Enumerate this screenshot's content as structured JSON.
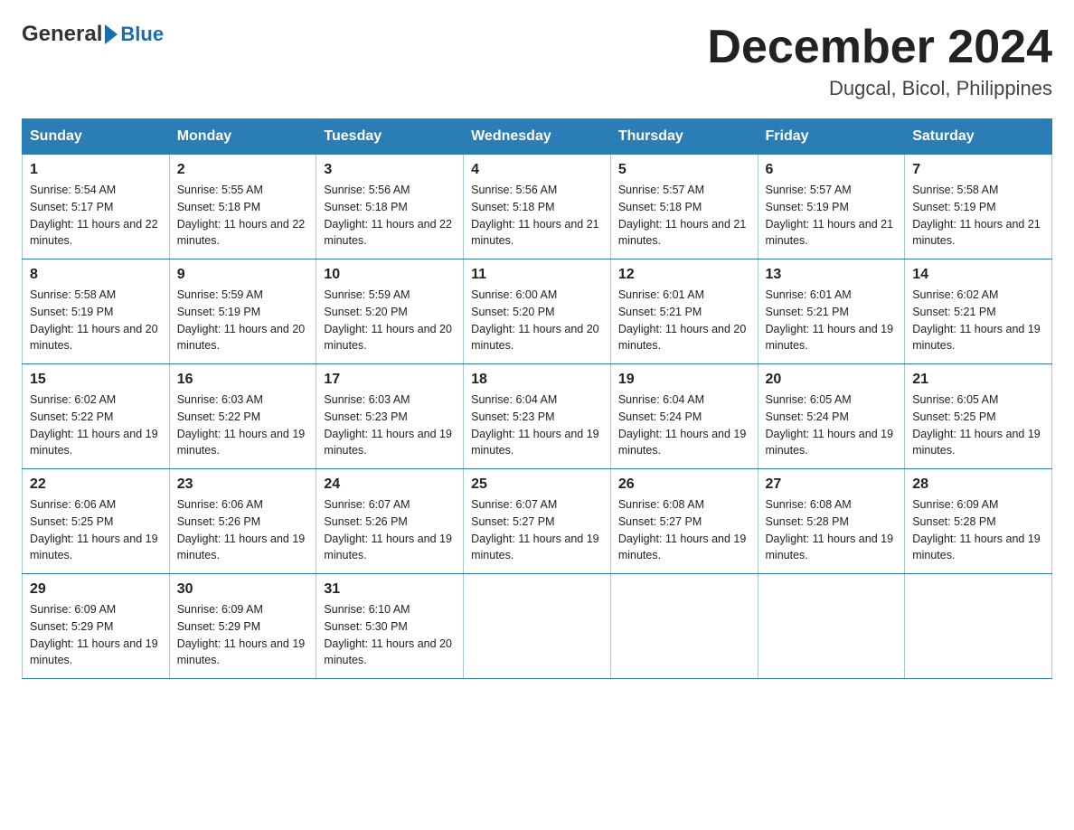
{
  "logo": {
    "general": "General",
    "blue": "Blue"
  },
  "title": "December 2024",
  "subtitle": "Dugcal, Bicol, Philippines",
  "days": [
    "Sunday",
    "Monday",
    "Tuesday",
    "Wednesday",
    "Thursday",
    "Friday",
    "Saturday"
  ],
  "weeks": [
    [
      {
        "num": "1",
        "sunrise": "5:54 AM",
        "sunset": "5:17 PM",
        "daylight": "11 hours and 22 minutes."
      },
      {
        "num": "2",
        "sunrise": "5:55 AM",
        "sunset": "5:18 PM",
        "daylight": "11 hours and 22 minutes."
      },
      {
        "num": "3",
        "sunrise": "5:56 AM",
        "sunset": "5:18 PM",
        "daylight": "11 hours and 22 minutes."
      },
      {
        "num": "4",
        "sunrise": "5:56 AM",
        "sunset": "5:18 PM",
        "daylight": "11 hours and 21 minutes."
      },
      {
        "num": "5",
        "sunrise": "5:57 AM",
        "sunset": "5:18 PM",
        "daylight": "11 hours and 21 minutes."
      },
      {
        "num": "6",
        "sunrise": "5:57 AM",
        "sunset": "5:19 PM",
        "daylight": "11 hours and 21 minutes."
      },
      {
        "num": "7",
        "sunrise": "5:58 AM",
        "sunset": "5:19 PM",
        "daylight": "11 hours and 21 minutes."
      }
    ],
    [
      {
        "num": "8",
        "sunrise": "5:58 AM",
        "sunset": "5:19 PM",
        "daylight": "11 hours and 20 minutes."
      },
      {
        "num": "9",
        "sunrise": "5:59 AM",
        "sunset": "5:19 PM",
        "daylight": "11 hours and 20 minutes."
      },
      {
        "num": "10",
        "sunrise": "5:59 AM",
        "sunset": "5:20 PM",
        "daylight": "11 hours and 20 minutes."
      },
      {
        "num": "11",
        "sunrise": "6:00 AM",
        "sunset": "5:20 PM",
        "daylight": "11 hours and 20 minutes."
      },
      {
        "num": "12",
        "sunrise": "6:01 AM",
        "sunset": "5:21 PM",
        "daylight": "11 hours and 20 minutes."
      },
      {
        "num": "13",
        "sunrise": "6:01 AM",
        "sunset": "5:21 PM",
        "daylight": "11 hours and 19 minutes."
      },
      {
        "num": "14",
        "sunrise": "6:02 AM",
        "sunset": "5:21 PM",
        "daylight": "11 hours and 19 minutes."
      }
    ],
    [
      {
        "num": "15",
        "sunrise": "6:02 AM",
        "sunset": "5:22 PM",
        "daylight": "11 hours and 19 minutes."
      },
      {
        "num": "16",
        "sunrise": "6:03 AM",
        "sunset": "5:22 PM",
        "daylight": "11 hours and 19 minutes."
      },
      {
        "num": "17",
        "sunrise": "6:03 AM",
        "sunset": "5:23 PM",
        "daylight": "11 hours and 19 minutes."
      },
      {
        "num": "18",
        "sunrise": "6:04 AM",
        "sunset": "5:23 PM",
        "daylight": "11 hours and 19 minutes."
      },
      {
        "num": "19",
        "sunrise": "6:04 AM",
        "sunset": "5:24 PM",
        "daylight": "11 hours and 19 minutes."
      },
      {
        "num": "20",
        "sunrise": "6:05 AM",
        "sunset": "5:24 PM",
        "daylight": "11 hours and 19 minutes."
      },
      {
        "num": "21",
        "sunrise": "6:05 AM",
        "sunset": "5:25 PM",
        "daylight": "11 hours and 19 minutes."
      }
    ],
    [
      {
        "num": "22",
        "sunrise": "6:06 AM",
        "sunset": "5:25 PM",
        "daylight": "11 hours and 19 minutes."
      },
      {
        "num": "23",
        "sunrise": "6:06 AM",
        "sunset": "5:26 PM",
        "daylight": "11 hours and 19 minutes."
      },
      {
        "num": "24",
        "sunrise": "6:07 AM",
        "sunset": "5:26 PM",
        "daylight": "11 hours and 19 minutes."
      },
      {
        "num": "25",
        "sunrise": "6:07 AM",
        "sunset": "5:27 PM",
        "daylight": "11 hours and 19 minutes."
      },
      {
        "num": "26",
        "sunrise": "6:08 AM",
        "sunset": "5:27 PM",
        "daylight": "11 hours and 19 minutes."
      },
      {
        "num": "27",
        "sunrise": "6:08 AM",
        "sunset": "5:28 PM",
        "daylight": "11 hours and 19 minutes."
      },
      {
        "num": "28",
        "sunrise": "6:09 AM",
        "sunset": "5:28 PM",
        "daylight": "11 hours and 19 minutes."
      }
    ],
    [
      {
        "num": "29",
        "sunrise": "6:09 AM",
        "sunset": "5:29 PM",
        "daylight": "11 hours and 19 minutes."
      },
      {
        "num": "30",
        "sunrise": "6:09 AM",
        "sunset": "5:29 PM",
        "daylight": "11 hours and 19 minutes."
      },
      {
        "num": "31",
        "sunrise": "6:10 AM",
        "sunset": "5:30 PM",
        "daylight": "11 hours and 20 minutes."
      },
      null,
      null,
      null,
      null
    ]
  ],
  "labels": {
    "sunrise": "Sunrise:",
    "sunset": "Sunset:",
    "daylight": "Daylight:"
  }
}
